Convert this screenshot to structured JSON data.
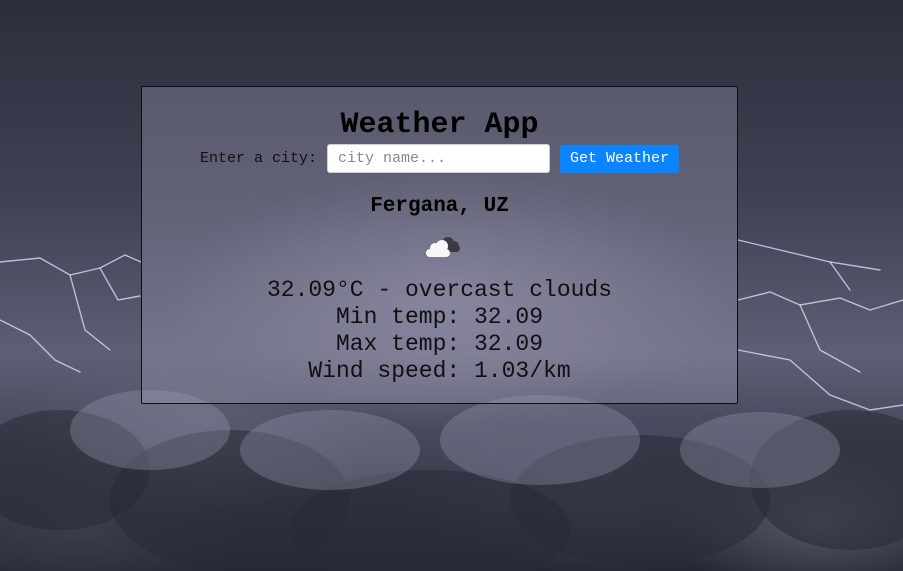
{
  "app": {
    "title": "Weather App"
  },
  "search": {
    "label": "Enter a city:",
    "placeholder": "city name...",
    "value": "",
    "button_label": "Get Weather"
  },
  "result": {
    "location": "Fergana, UZ",
    "icon": "overcast-clouds-icon",
    "summary": "32.09°C - overcast clouds",
    "min_temp": "Min temp: 32.09",
    "max_temp": "Max temp: 32.09",
    "wind_speed": "Wind speed: 1.03/km"
  },
  "colors": {
    "button_bg": "#0a84ff",
    "button_text": "#ffffff",
    "card_border": "#0e0e12",
    "text": "#000000"
  }
}
